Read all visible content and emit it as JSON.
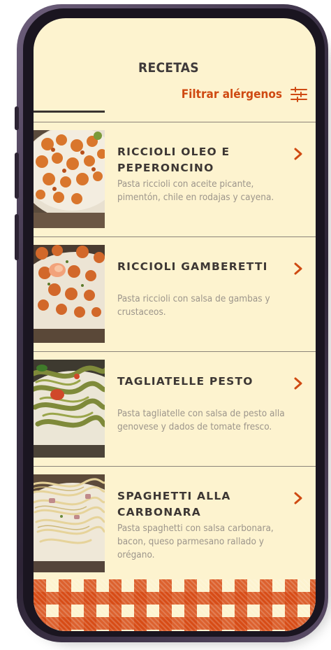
{
  "header": {
    "title": "RECETAS",
    "filter_label": "Filtrar alérgenos",
    "filter_icon": "sliders-icon"
  },
  "recipes": [
    {
      "title": "RICCIOLI OLEO E PEPERONCINO",
      "description": "Pasta riccioli con aceite picante, pimentón, chile en rodajas y cayena."
    },
    {
      "title": "RICCIOLI GAMBERETTI",
      "description": "Pasta riccioli con salsa de gambas y crustaceos."
    },
    {
      "title": "TAGLIATELLE PESTO",
      "description": "Pasta tagliatelle con salsa de pesto alla genovese y dados de tomate fresco."
    },
    {
      "title": "SPAGHETTI ALLA CARBONARA",
      "description": "Pasta spaghetti con salsa carbonara, bacon, queso parmesano rallado y orégano."
    }
  ],
  "colors": {
    "background": "#fdf3cf",
    "accent": "#cf4a12",
    "title_text": "#3d3734",
    "description_text": "#9c958b",
    "divider": "#8b8479",
    "phone_frame": "#3b3146"
  }
}
